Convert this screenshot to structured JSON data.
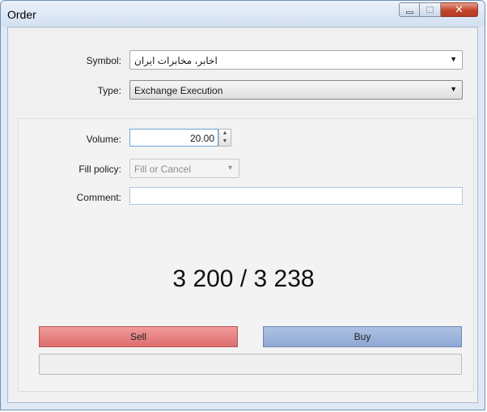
{
  "window": {
    "title": "Order"
  },
  "form": {
    "symbol_label": "Symbol:",
    "symbol_value": "اخابر، مخابرات ایران",
    "type_label": "Type:",
    "type_value": "Exchange Execution",
    "volume_label": "Volume:",
    "volume_value": "20.00",
    "fill_policy_label": "Fill policy:",
    "fill_policy_value": "Fill or Cancel",
    "comment_label": "Comment:",
    "comment_value": ""
  },
  "quote": {
    "text": "3 200 / 3 238"
  },
  "actions": {
    "sell_label": "Sell",
    "buy_label": "Buy"
  },
  "colors": {
    "sell": "#e07a7a",
    "buy": "#9cb4dc",
    "titlebar": "#dfe9f5"
  },
  "icons": {
    "minimize": "minimize-icon",
    "maximize": "maximize-icon",
    "close": "close-icon",
    "dropdown": "chevron-down-icon",
    "spinner": "spinner-icon"
  }
}
